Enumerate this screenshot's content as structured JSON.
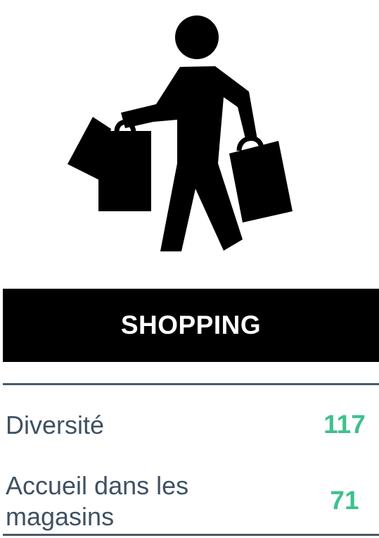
{
  "icon": "shopping-person-icon",
  "banner": {
    "title": "SHOPPING",
    "background": "#000000",
    "text_color": "#ffffff"
  },
  "colors": {
    "label": "#3f5163",
    "value": "#3fc08e",
    "rule": "#4a5a66"
  },
  "metrics": [
    {
      "label": "Diversité",
      "value": "117"
    },
    {
      "label": "Accueil dans les magasins",
      "value": "71"
    }
  ]
}
